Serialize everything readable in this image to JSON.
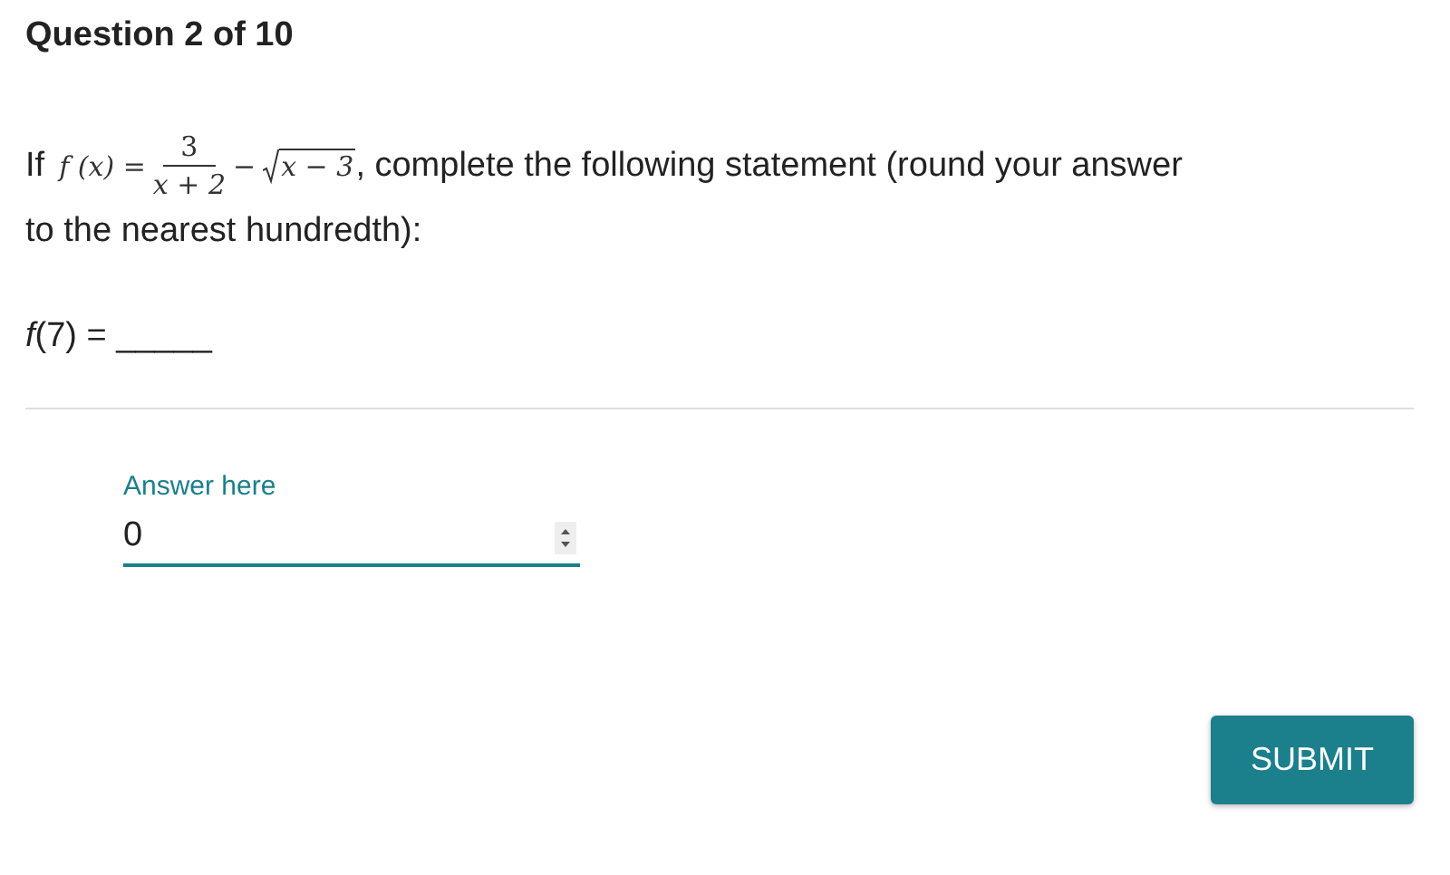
{
  "header": {
    "title": "Question 2 of 10"
  },
  "prompt": {
    "lead": "If",
    "formula": {
      "lhs": "f (x) =",
      "numerator": "3",
      "denominator": "x + 2",
      "minus": "−",
      "radicand": "x − 3"
    },
    "line_1_rest": ", complete the following statement (round your answer",
    "line_2": "to the nearest hundredth):"
  },
  "statement": "*f*(7) = _____",
  "answer": {
    "label": "Answer here",
    "value": "0"
  },
  "buttons": [
    {
      "label": "SUBMIT"
    }
  ]
}
